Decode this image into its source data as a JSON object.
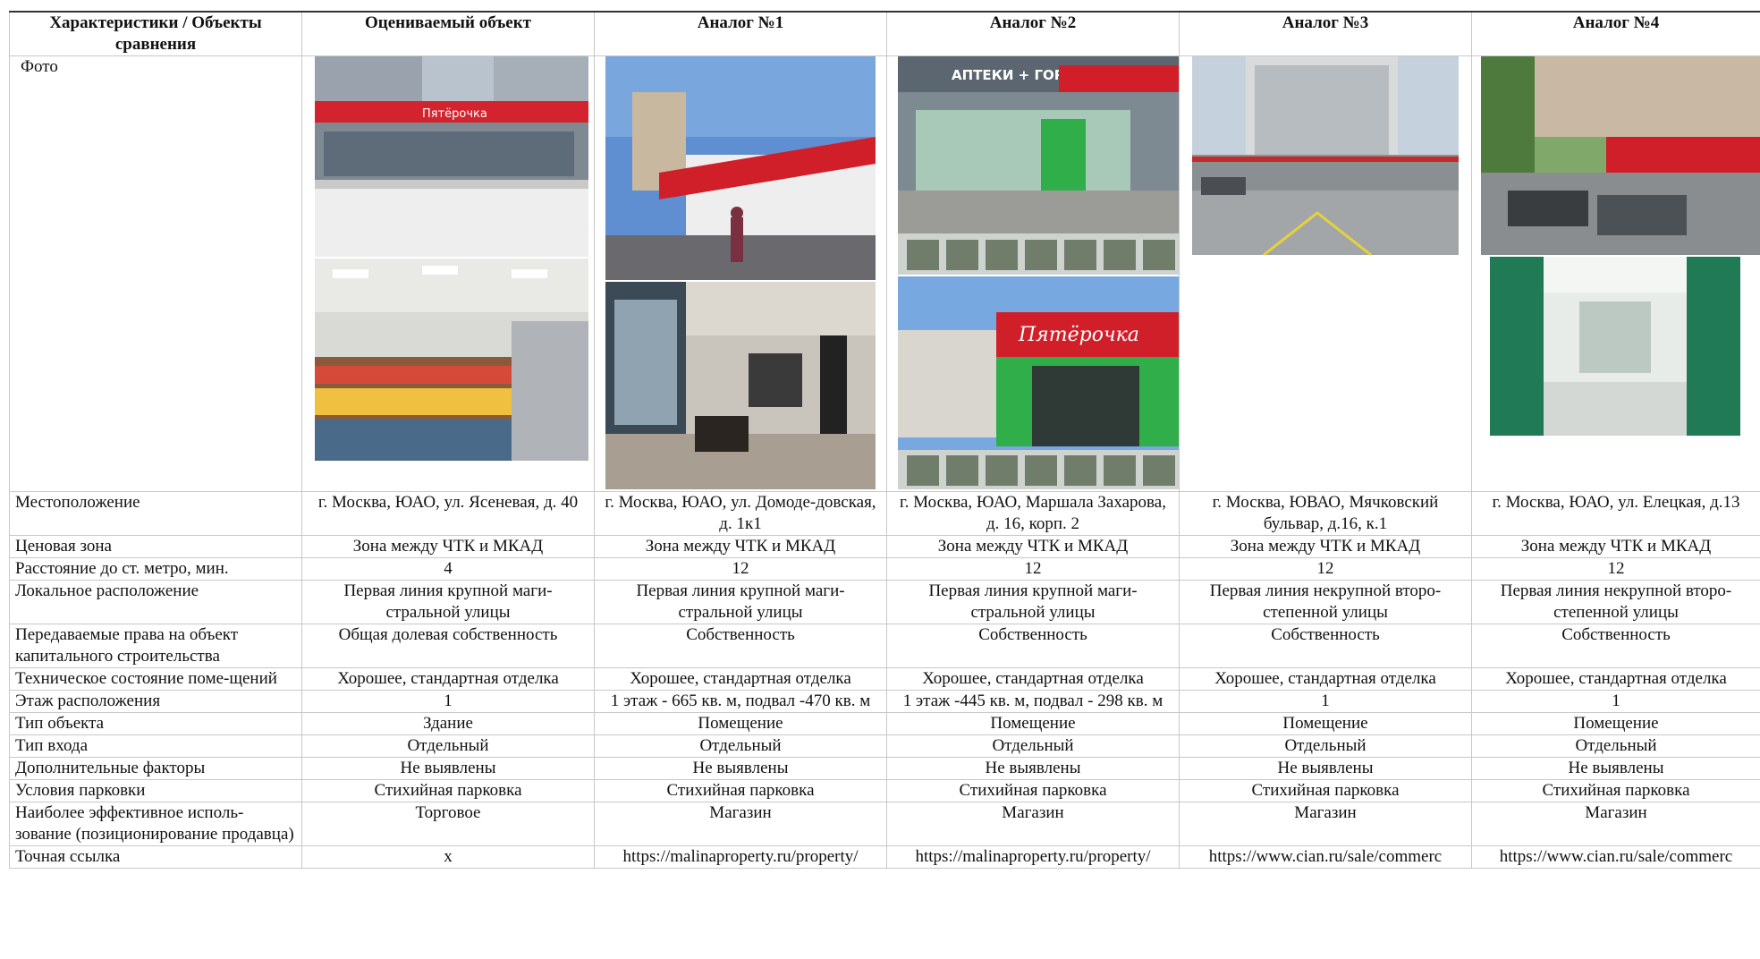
{
  "headers": [
    "Характеристики / Объекты сравнения",
    "Оцениваемый объект",
    "Аналог №1",
    "Аналог №2",
    "Аналог №3",
    "Аналог №4"
  ],
  "photo_label": "Фото",
  "photo_sign_texts": {
    "pyaterochka_sign": "Пятёрочка",
    "apteki_sign": "АПТЕКИ + ГОРЗДРАВ"
  },
  "rows": [
    {
      "label": "Местоположение",
      "values": [
        "г. Москва, ЮАО, ул. Ясеневая, д. 40",
        "г. Москва, ЮАО, ул. Домоде-довская, д. 1к1",
        "г. Москва, ЮАО, Маршала Захарова, д. 16, корп. 2",
        "г. Москва, ЮВАО, Мячковский бульвар, д.16, к.1",
        "г. Москва, ЮАО, ул. Елецкая, д.13"
      ]
    },
    {
      "label": "Ценовая зона",
      "values": [
        "Зона между ЧТК и МКАД",
        "Зона между ЧТК и МКАД",
        "Зона между ЧТК и МКАД",
        "Зона между ЧТК и МКАД",
        "Зона между ЧТК и МКАД"
      ]
    },
    {
      "label": "Расстояние до ст. метро, мин.",
      "values": [
        "4",
        "12",
        "12",
        "12",
        "12"
      ]
    },
    {
      "label": "Локальное расположение",
      "values": [
        "Первая линия крупной маги-стральной улицы",
        "Первая линия крупной маги-стральной улицы",
        "Первая линия крупной маги-стральной улицы",
        "Первая линия некрупной второ-степенной улицы",
        "Первая линия некрупной второ-степенной улицы"
      ]
    },
    {
      "label": "Передаваемые права на объект капитального строительства",
      "values": [
        "Общая долевая собственность",
        "Собственность",
        "Собственность",
        "Собственность",
        "Собственность"
      ]
    },
    {
      "label": "Техническое состояние поме-щений",
      "values": [
        "Хорошее, стандартная отделка",
        "Хорошее, стандартная отделка",
        "Хорошее, стандартная отделка",
        "Хорошее, стандартная отделка",
        "Хорошее, стандартная отделка"
      ]
    },
    {
      "label": "Этаж расположения",
      "values": [
        "1",
        "1 этаж - 665 кв. м, подвал -470 кв. м",
        "1 этаж -445 кв. м, подвал - 298 кв. м",
        "1",
        "1"
      ]
    },
    {
      "label": "Тип объекта",
      "values": [
        "Здание",
        "Помещение",
        "Помещение",
        "Помещение",
        "Помещение"
      ]
    },
    {
      "label": "Тип входа",
      "values": [
        "Отдельный",
        "Отдельный",
        "Отдельный",
        "Отдельный",
        "Отдельный"
      ]
    },
    {
      "label": "Дополнительные факторы",
      "values": [
        "Не выявлены",
        "Не выявлены",
        "Не выявлены",
        "Не выявлены",
        "Не выявлены"
      ]
    },
    {
      "label": "Условия парковки",
      "values": [
        "Стихийная парковка",
        "Стихийная парковка",
        "Стихийная парковка",
        "Стихийная парковка",
        "Стихийная парковка"
      ]
    },
    {
      "label": "Наиболее эффективное исполь-зование (позиционирование продавца)",
      "values": [
        "Торговое",
        "Магазин",
        "Магазин",
        "Магазин",
        "Магазин"
      ]
    },
    {
      "label": "Точная ссылка",
      "values": [
        "х",
        "https://malinaproperty.ru/property/",
        "https://malinaproperty.ru/property/",
        "https://www.cian.ru/sale/commerc",
        "https://www.cian.ru/sale/commerc"
      ]
    }
  ]
}
